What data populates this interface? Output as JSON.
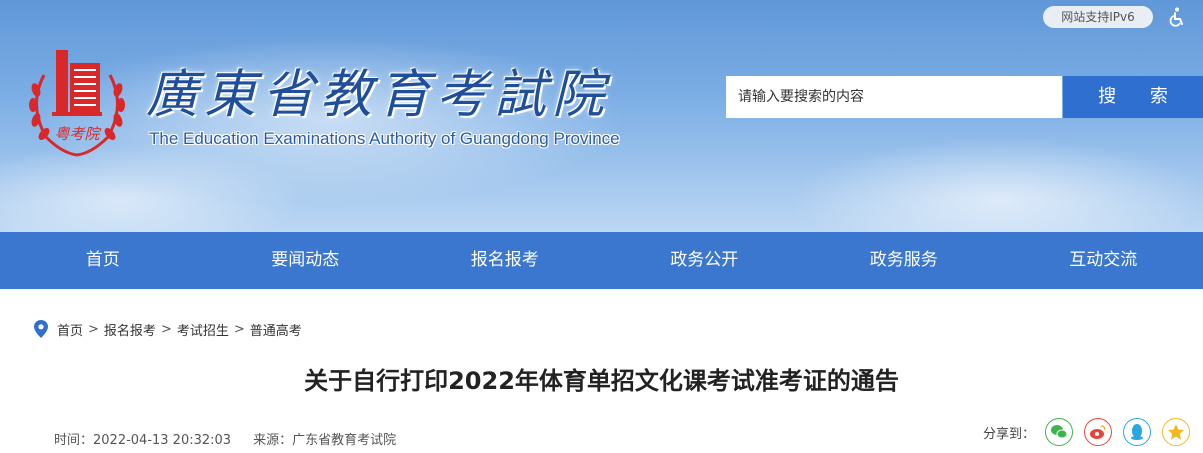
{
  "header": {
    "ipv6_label": "网站支持IPv6",
    "site_title": "廣東省教育考試院",
    "site_subtitle": "The Education Examinations Authority of Guangdong Province",
    "logo_text": "粤考院"
  },
  "search": {
    "placeholder": "请输入要搜索的内容",
    "button_label": "搜 索"
  },
  "nav": {
    "items": [
      "首页",
      "要闻动态",
      "报名报考",
      "政务公开",
      "政务服务",
      "互动交流"
    ]
  },
  "breadcrumb": {
    "items": [
      "首页",
      "报名报考",
      "考试招生",
      "普通高考"
    ],
    "separator": ">"
  },
  "article": {
    "title": "关于自行打印2022年体育单招文化课考试准考证的通告",
    "time": "时间：2022-04-13 20:32:03",
    "source": "来源：广东省教育考试院"
  },
  "share": {
    "label": "分享到：",
    "icons": [
      "wechat-icon",
      "weibo-icon",
      "qq-icon",
      "qzone-icon"
    ]
  },
  "colors": {
    "nav_bg": "#3b76cf",
    "search_btn": "#2f6fd0",
    "title_blue": "#1f4f9a",
    "logo_red": "#d8282a",
    "share_green": "#3fb34f",
    "share_red": "#e4463b",
    "share_blue": "#2aa7e0",
    "share_yellow": "#f2b81f"
  }
}
